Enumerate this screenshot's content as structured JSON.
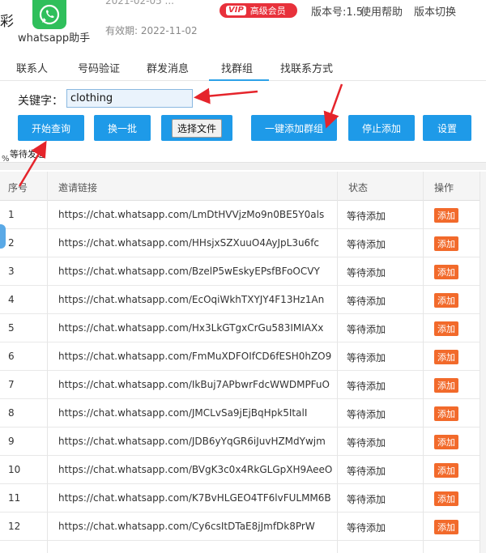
{
  "header": {
    "cut_char": "彩",
    "app_name": "whatsapp助手",
    "partial_date": "2021-02-05 ...",
    "valid_until": "有效期: 2022-11-02",
    "vip_tag": "VIP",
    "vip_label": "高级会员",
    "version": "版本号:1.5",
    "help": "使用帮助",
    "switch_version": "版本切换"
  },
  "tabs": [
    "联系人",
    "号码验证",
    "群发消息",
    "找群组",
    "找联系方式"
  ],
  "active_tab": "找群组",
  "search": {
    "label": "关键字：",
    "value": "clothing"
  },
  "buttons": {
    "start": "开始查询",
    "next_batch": "换一批",
    "choose_file": "选择文件",
    "add_all": "一键添加群组",
    "stop_add": "停止添加",
    "settings": "设置"
  },
  "status_line": "等待发送",
  "percent": "%",
  "table": {
    "headers": [
      "序号",
      "邀请链接",
      "状态",
      "操作"
    ],
    "rows": [
      {
        "num": "1",
        "link": "https://chat.whatsapp.com/LmDtHVVjzMo9n0BE5Y0als",
        "status": "等待添加",
        "action": "添加"
      },
      {
        "num": "2",
        "link": "https://chat.whatsapp.com/HHsjxSZXuuO4AyJpL3u6fc",
        "status": "等待添加",
        "action": "添加"
      },
      {
        "num": "3",
        "link": "https://chat.whatsapp.com/BzelP5wEskyEPsfBFoOCVY",
        "status": "等待添加",
        "action": "添加"
      },
      {
        "num": "4",
        "link": "https://chat.whatsapp.com/EcOqiWkhTXYJY4F13Hz1An",
        "status": "等待添加",
        "action": "添加"
      },
      {
        "num": "5",
        "link": "https://chat.whatsapp.com/Hx3LkGTgxCrGu583IMIAXx",
        "status": "等待添加",
        "action": "添加"
      },
      {
        "num": "6",
        "link": "https://chat.whatsapp.com/FmMuXDFOIfCD6fESH0hZO9",
        "status": "等待添加",
        "action": "添加"
      },
      {
        "num": "7",
        "link": "https://chat.whatsapp.com/IkBuj7APbwrFdcWWDMPFuO",
        "status": "等待添加",
        "action": "添加"
      },
      {
        "num": "8",
        "link": "https://chat.whatsapp.com/JMCLvSa9jEjBqHpk5ItalI",
        "status": "等待添加",
        "action": "添加"
      },
      {
        "num": "9",
        "link": "https://chat.whatsapp.com/JDB6yYqGR6iJuvHZMdYwjm",
        "status": "等待添加",
        "action": "添加"
      },
      {
        "num": "10",
        "link": "https://chat.whatsapp.com/BVgK3c0x4RkGLGpXH9AeeO",
        "status": "等待添加",
        "action": "添加"
      },
      {
        "num": "11",
        "link": "https://chat.whatsapp.com/K7BvHLGEO4TF6lvFULMM6B",
        "status": "等待添加",
        "action": "添加"
      },
      {
        "num": "12",
        "link": "https://chat.whatsapp.com/Cy6csItDTaE8jJmfDk8PrW",
        "status": "等待添加",
        "action": "添加"
      }
    ]
  },
  "colors": {
    "primary": "#1e9ae8",
    "add_button": "#f26a2b",
    "vip": "#e8313b",
    "whatsapp_green": "#2fbf5b",
    "annotation_arrow": "#e5242b"
  },
  "icons": {
    "logo": "whatsapp-phone-icon"
  }
}
